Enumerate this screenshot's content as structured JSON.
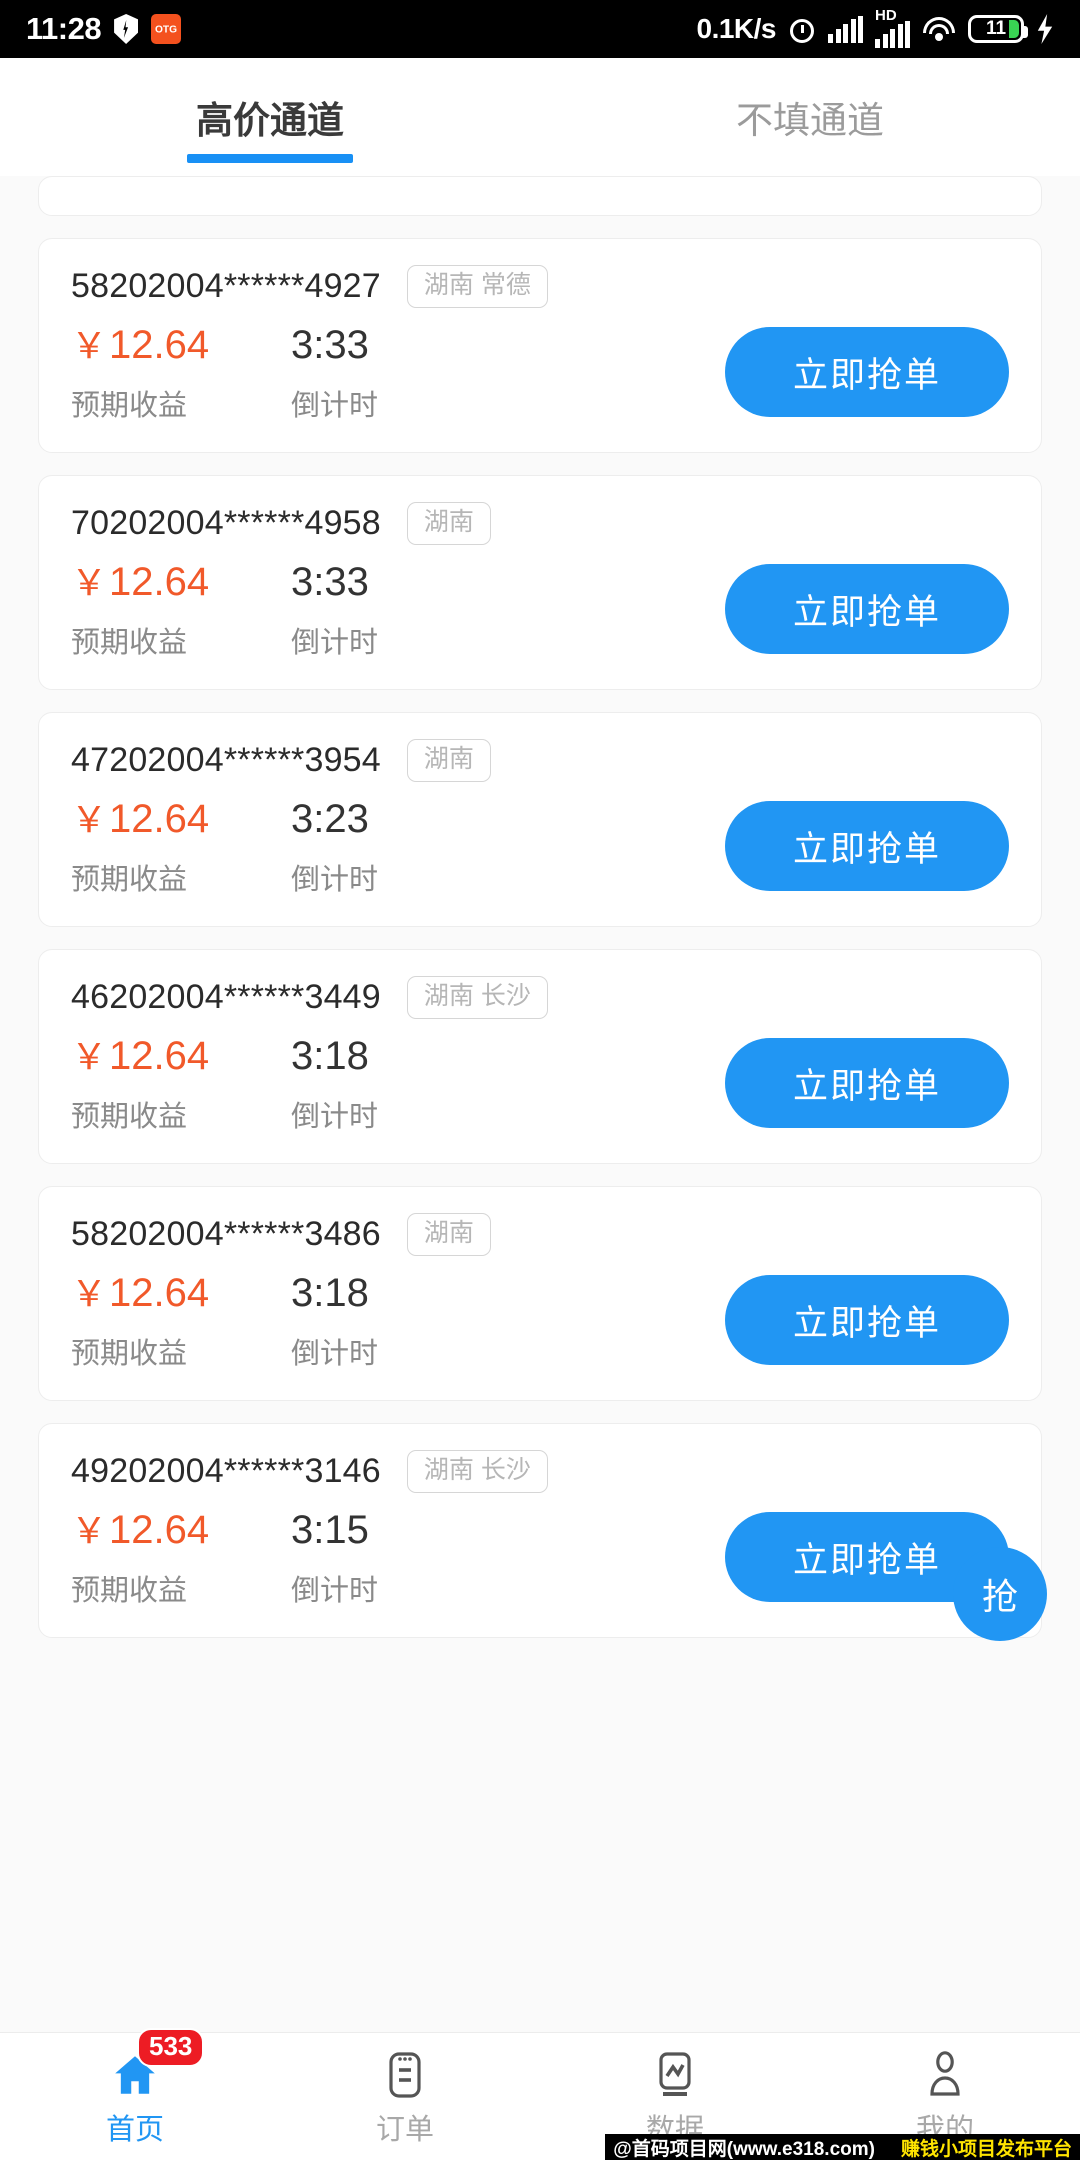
{
  "statusbar": {
    "time": "11:28",
    "network_speed": "0.1K/s",
    "battery_level": "11",
    "hd_label": "HD",
    "icons": [
      "shield-icon",
      "otg-icon",
      "alarm-icon",
      "signal-icon",
      "signal-hd-icon",
      "wifi-icon",
      "battery-icon",
      "charging-bolt-icon"
    ]
  },
  "tabs": [
    {
      "label": "高价通道",
      "active": true
    },
    {
      "label": "不填通道",
      "active": false
    }
  ],
  "labels": {
    "earnings": "预期收益",
    "countdown": "倒计时",
    "grab": "立即抢单",
    "fab": "抢",
    "yen": "￥"
  },
  "colors": {
    "accent": "#2196F3",
    "price": "#F1592A",
    "badge": "#ED1C24",
    "tab_indicator": "#1890f5"
  },
  "orders": [
    {
      "order_no": "58202004******4927",
      "region": "湖南 常德",
      "price": "12.64",
      "countdown": "3:33"
    },
    {
      "order_no": "70202004******4958",
      "region": "湖南",
      "price": "12.64",
      "countdown": "3:33"
    },
    {
      "order_no": "47202004******3954",
      "region": "湖南",
      "price": "12.64",
      "countdown": "3:23"
    },
    {
      "order_no": "46202004******3449",
      "region": "湖南 长沙",
      "price": "12.64",
      "countdown": "3:18"
    },
    {
      "order_no": "58202004******3486",
      "region": "湖南",
      "price": "12.64",
      "countdown": "3:18"
    },
    {
      "order_no": "49202004******3146",
      "region": "湖南 长沙",
      "price": "12.64",
      "countdown": "3:15"
    }
  ],
  "bottomnav": [
    {
      "label": "首页",
      "icon": "home-icon",
      "active": true,
      "badge": "533"
    },
    {
      "label": "订单",
      "icon": "order-icon",
      "active": false,
      "badge": ""
    },
    {
      "label": "数据",
      "icon": "chart-icon",
      "active": false,
      "badge": ""
    },
    {
      "label": "我的",
      "icon": "user-icon",
      "active": false,
      "badge": ""
    }
  ],
  "watermark": {
    "site": "@首码项目网(www.e318.com)",
    "slogan": "赚钱小项目发布平台"
  }
}
